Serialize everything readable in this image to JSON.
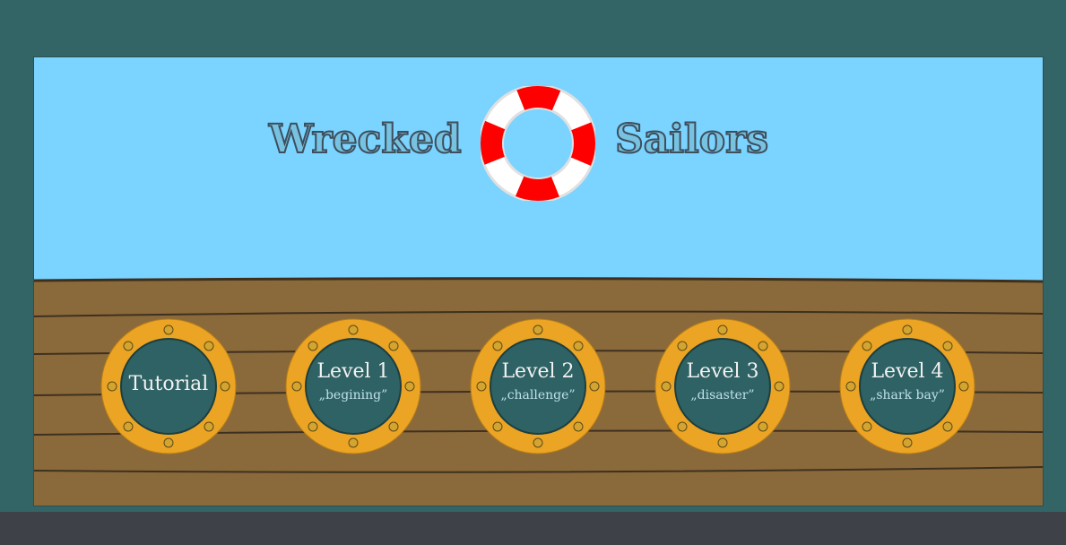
{
  "game": {
    "title_left": "Wrecked",
    "title_right": "Sailors"
  },
  "levels": [
    {
      "label": "Tutorial",
      "subtitle": ""
    },
    {
      "label": "Level 1",
      "subtitle": "„begining”"
    },
    {
      "label": "Level 2",
      "subtitle": "„challenge”"
    },
    {
      "label": "Level 3",
      "subtitle": "„disaster”"
    },
    {
      "label": "Level 4",
      "subtitle": "„shark bay”"
    }
  ],
  "colors": {
    "background": "#336466",
    "sky": "#7bd3ff",
    "deck": "#8a6a3a",
    "plank_line": "#3e3020",
    "porthole_ring": "#eba424",
    "porthole_glass": "#2f6264",
    "lifebuoy_red": "#ff0000",
    "bottom_bar": "#3e4248"
  }
}
